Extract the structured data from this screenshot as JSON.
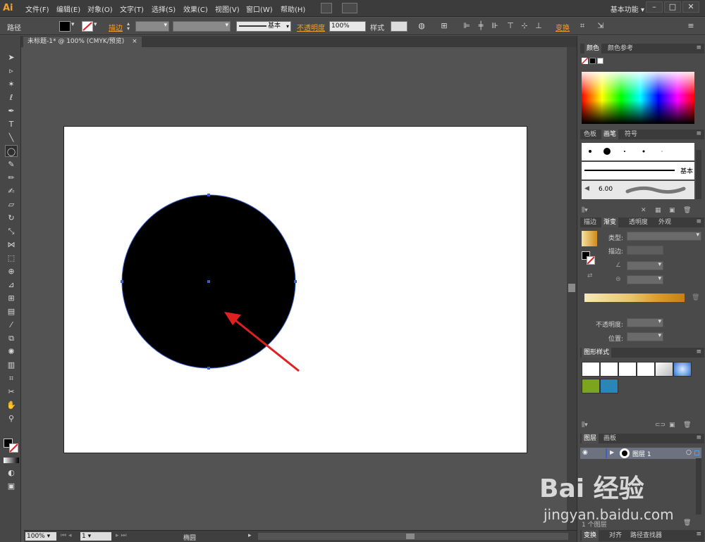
{
  "app": {
    "logo": "Ai",
    "workspace": "基本功能"
  },
  "menu": [
    "文件(F)",
    "编辑(E)",
    "对象(O)",
    "文字(T)",
    "选择(S)",
    "效果(C)",
    "视图(V)",
    "窗口(W)",
    "帮助(H)"
  ],
  "window_buttons": [
    "–",
    "□",
    "✕"
  ],
  "control_bar": {
    "selection_label": "路径",
    "stroke_label": "描边",
    "stroke_profile": "基本",
    "opacity_label": "不透明度",
    "opacity_value": "100%",
    "style_label": "样式",
    "transform_label": "变换"
  },
  "document": {
    "tab_title": "未标题-1* @ 100% (CMYK/预览)",
    "tab_close": "×"
  },
  "status_bar": {
    "zoom": "100%",
    "artboard": "1",
    "tool_name": "椭圆"
  },
  "panels": {
    "color_tabs": [
      "颜色",
      "颜色参考"
    ],
    "brush_tabs": [
      "色板",
      "画笔",
      "符号"
    ],
    "brush_basic": "基本",
    "brush_size": "6.00",
    "gradient_tabs": [
      "描边",
      "渐变",
      "透明度",
      "外观"
    ],
    "gradient_type_label": "类型:",
    "gradient_stroke_label": "描边:",
    "gradient_opacity_label": "不透明度:",
    "gradient_position_label": "位置:",
    "graphic_styles_tab": "图形样式",
    "layers_tabs": [
      "图层",
      "画板"
    ],
    "layer_name": "图层 1",
    "layer_count": "1 个图层",
    "bottom_tabs": [
      "变换",
      "对齐",
      "路径查找器"
    ]
  },
  "watermark": {
    "logo": "Bai 经验",
    "url": "jingyan.baidu.com"
  },
  "colors": {
    "accent": "#f0a030",
    "selection_outline": "#3b5ec9",
    "arrow": "#e02020",
    "circle_fill": "#000000"
  }
}
